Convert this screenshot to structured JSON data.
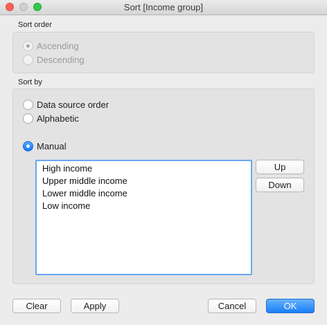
{
  "window": {
    "title": "Sort [Income group]"
  },
  "sort_order": {
    "label": "Sort order",
    "options": [
      {
        "label": "Ascending",
        "checked": true,
        "disabled": true
      },
      {
        "label": "Descending",
        "checked": false,
        "disabled": true
      }
    ]
  },
  "sort_by": {
    "label": "Sort by",
    "options": [
      {
        "label": "Data source order",
        "checked": false
      },
      {
        "label": "Alphabetic",
        "checked": false
      },
      {
        "label": "Manual",
        "checked": true
      }
    ],
    "manual_items": [
      "High income",
      "Upper middle income",
      "Lower middle income",
      "Low income"
    ],
    "up_label": "Up",
    "down_label": "Down"
  },
  "footer": {
    "clear_label": "Clear",
    "apply_label": "Apply",
    "cancel_label": "Cancel",
    "ok_label": "OK"
  }
}
